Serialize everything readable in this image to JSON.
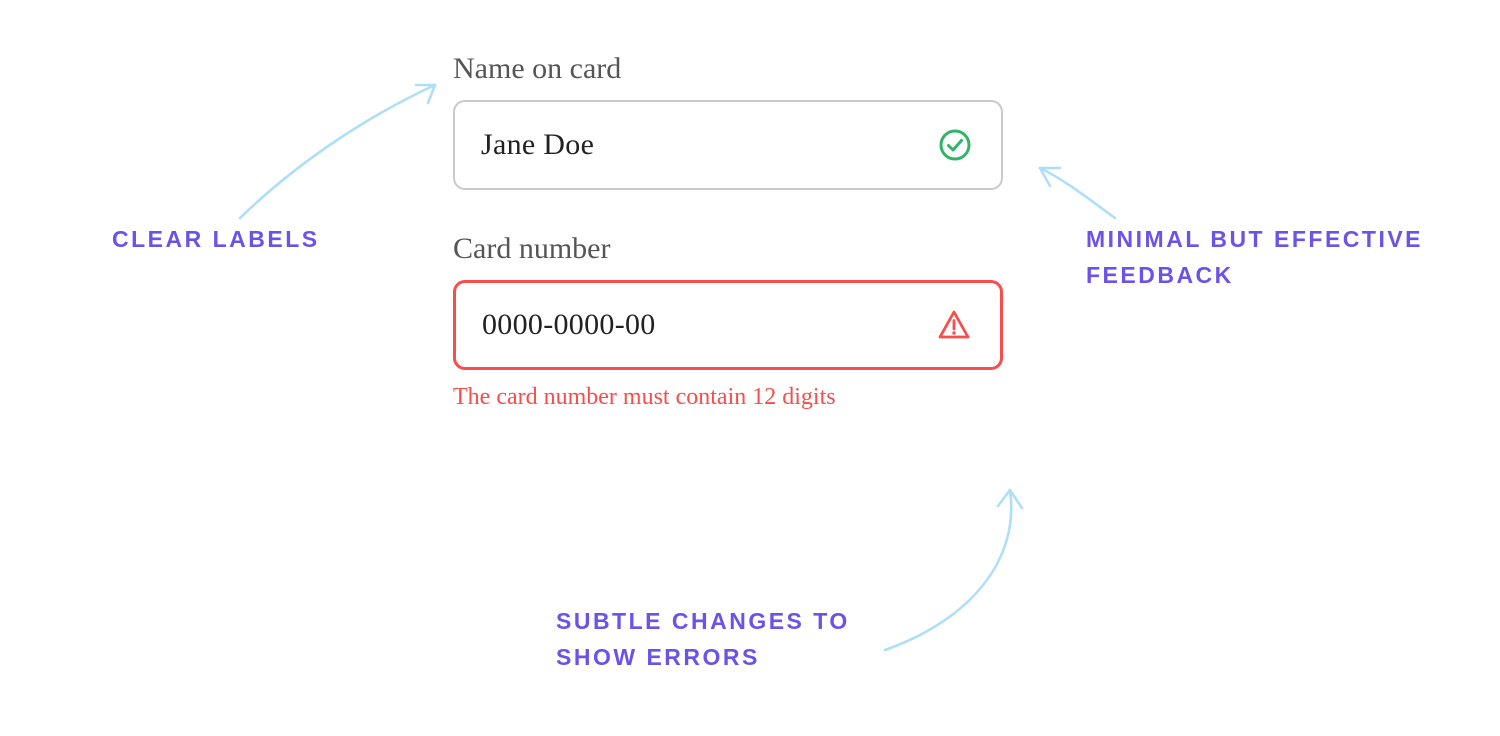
{
  "form": {
    "name_field": {
      "label": "Name on card",
      "value": "Jane Doe",
      "state": "valid"
    },
    "card_field": {
      "label": "Card number",
      "value": "0000-0000-00",
      "state": "invalid",
      "error": "The card number must contain 12 digits"
    }
  },
  "annotations": {
    "clear_labels": "CLEAR LABELS",
    "minimal_feedback": "MINIMAL BUT EFFECTIVE FEEDBACK",
    "subtle_errors": "SUBTLE CHANGES TO SHOW ERRORS"
  },
  "colors": {
    "annotation": "#6d52e7",
    "error": "#f84d4a",
    "success": "#32b56a",
    "arrow": "#aedff7",
    "label_text": "#555555",
    "input_border_neutral": "#c9c9c9"
  },
  "chart_data": {
    "type": "table",
    "title": "Annotated form-design example illustrating clear labels, minimal feedback, and subtle error states",
    "fields": [
      {
        "label": "Name on card",
        "value": "Jane Doe",
        "status": "valid",
        "message": ""
      },
      {
        "label": "Card number",
        "value": "0000-0000-00",
        "status": "invalid",
        "message": "The card number must contain 12 digits"
      }
    ],
    "principles": [
      "CLEAR LABELS",
      "MINIMAL BUT EFFECTIVE FEEDBACK",
      "SUBTLE CHANGES TO SHOW ERRORS"
    ]
  }
}
